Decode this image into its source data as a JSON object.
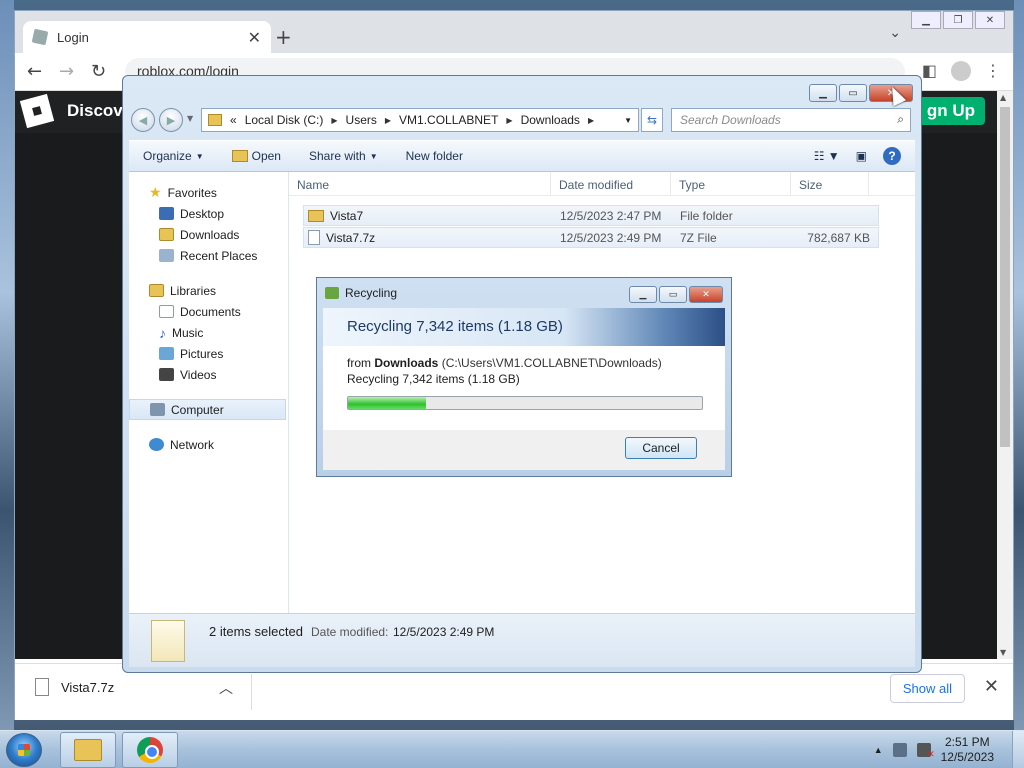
{
  "chrome": {
    "tab_title": "Login",
    "address": "roblox.com/login",
    "new_tab_symbol": "+",
    "tab_close_symbol": "✕",
    "site_header_text": "Discov",
    "signup_label": "gn Up",
    "download_item": "Vista7.7z",
    "show_all_label": "Show all"
  },
  "explorer": {
    "breadcrumb": [
      "«",
      "Local Disk (C:)",
      "Users",
      "VM1.COLLABNET",
      "Downloads"
    ],
    "search_placeholder": "Search Downloads",
    "toolbar": {
      "organize": "Organize",
      "open": "Open",
      "share_with": "Share with",
      "new_folder": "New folder"
    },
    "nav": {
      "favorites": "Favorites",
      "desktop": "Desktop",
      "downloads": "Downloads",
      "recent_places": "Recent Places",
      "libraries": "Libraries",
      "documents": "Documents",
      "music": "Music",
      "pictures": "Pictures",
      "videos": "Videos",
      "computer": "Computer",
      "network": "Network"
    },
    "columns": {
      "name": "Name",
      "date": "Date modified",
      "type": "Type",
      "size": "Size"
    },
    "files": [
      {
        "name": "Vista7",
        "date": "12/5/2023 2:47 PM",
        "type": "File folder",
        "size": ""
      },
      {
        "name": "Vista7.7z",
        "date": "12/5/2023 2:49 PM",
        "type": "7Z File",
        "size": "782,687 KB"
      }
    ],
    "details": {
      "title": "2 items selected",
      "date_label": "Date modified:",
      "date_value": "12/5/2023 2:49 PM"
    }
  },
  "recycle_dialog": {
    "title": "Recycling",
    "heading": "Recycling 7,342 items (1.18 GB)",
    "from_prefix": "from",
    "from_folder": "Downloads",
    "from_path": "(C:\\Users\\VM1.COLLABNET\\Downloads)",
    "status": "Recycling 7,342 items (1.18 GB)",
    "progress_fraction": 0.22,
    "cancel_label": "Cancel"
  },
  "taskbar": {
    "time": "2:51 PM",
    "date": "12/5/2023"
  }
}
